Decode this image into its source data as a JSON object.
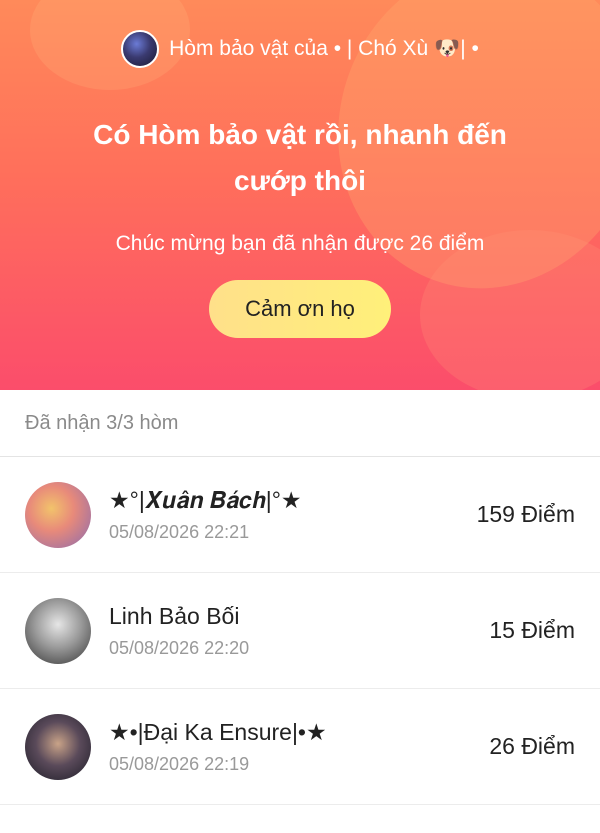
{
  "header": {
    "creator_text": "Hòm bảo vật của • | Chó Xù 🐶| •",
    "headline": "Có Hòm bảo vật rồi, nhanh đến cướp thôi",
    "points_message": "Chúc mừng bạn đã nhận được 26 điểm",
    "thanks_button": "Cảm ơn họ"
  },
  "received_label": "Đã nhận 3/3 hòm",
  "recipients": [
    {
      "name": "★°|𝑿𝒖𝒂̂𝒏 𝑩𝒂́𝒄𝒉|°★",
      "time": "05/08/2026 22:21",
      "points": "159 Điểm"
    },
    {
      "name": "Linh Bảo Bối",
      "time": "05/08/2026 22:20",
      "points": "15 Điểm"
    },
    {
      "name": "★•|Đại Ka Ensure|•★",
      "time": "05/08/2026 22:19",
      "points": "26 Điểm"
    }
  ],
  "colors": {
    "gradient_top": "#ff8a5a",
    "gradient_bottom": "#fb4d6b",
    "button": "#ffe08a"
  }
}
